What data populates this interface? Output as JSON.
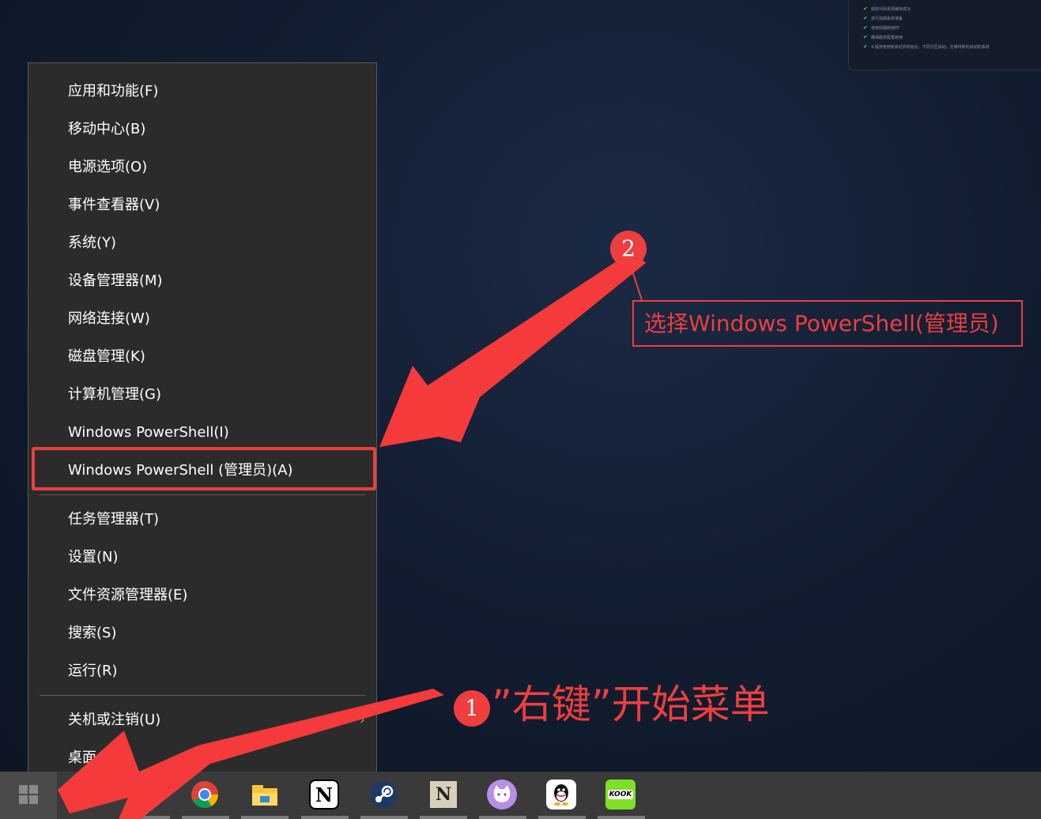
{
  "notification": {
    "lines": [
      "获取代码资源缓存成功",
      "进行前期系统准备",
      "使用前期启用RT",
      "确保服务配置启用",
      "4.程序使用新启动并初始化，不同分区启动，在等待新的启动的系统"
    ]
  },
  "context_menu": {
    "items": [
      "应用和功能(F)",
      "移动中心(B)",
      "电源选项(O)",
      "事件查看器(V)",
      "系统(Y)",
      "设备管理器(M)",
      "网络连接(W)",
      "磁盘管理(K)",
      "计算机管理(G)",
      "Windows PowerShell(I)",
      "Windows PowerShell (管理员)(A)",
      "任务管理器(T)",
      "设置(N)",
      "文件资源管理器(E)",
      "搜索(S)",
      "运行(R)",
      "关机或注销(U)",
      "桌面"
    ],
    "submenu_chevron": "›"
  },
  "annotations": {
    "badge1": "1",
    "badge2": "2",
    "step1_text": "”右键”开始菜单",
    "step2_text": "选择Windows PowerShell(管理员)",
    "accent_color": "#ee3e3e"
  },
  "taskbar": {
    "icons": [
      "windows-start-icon",
      "search-icon",
      "edge-icon",
      "chrome-icon",
      "file-explorer-icon",
      "notion-icon",
      "steam-icon",
      "notion-enhanced-icon",
      "cat-app-icon",
      "qq-icon",
      "kook-icon"
    ],
    "notion_letter": "N",
    "kook_label": "KOOK"
  }
}
